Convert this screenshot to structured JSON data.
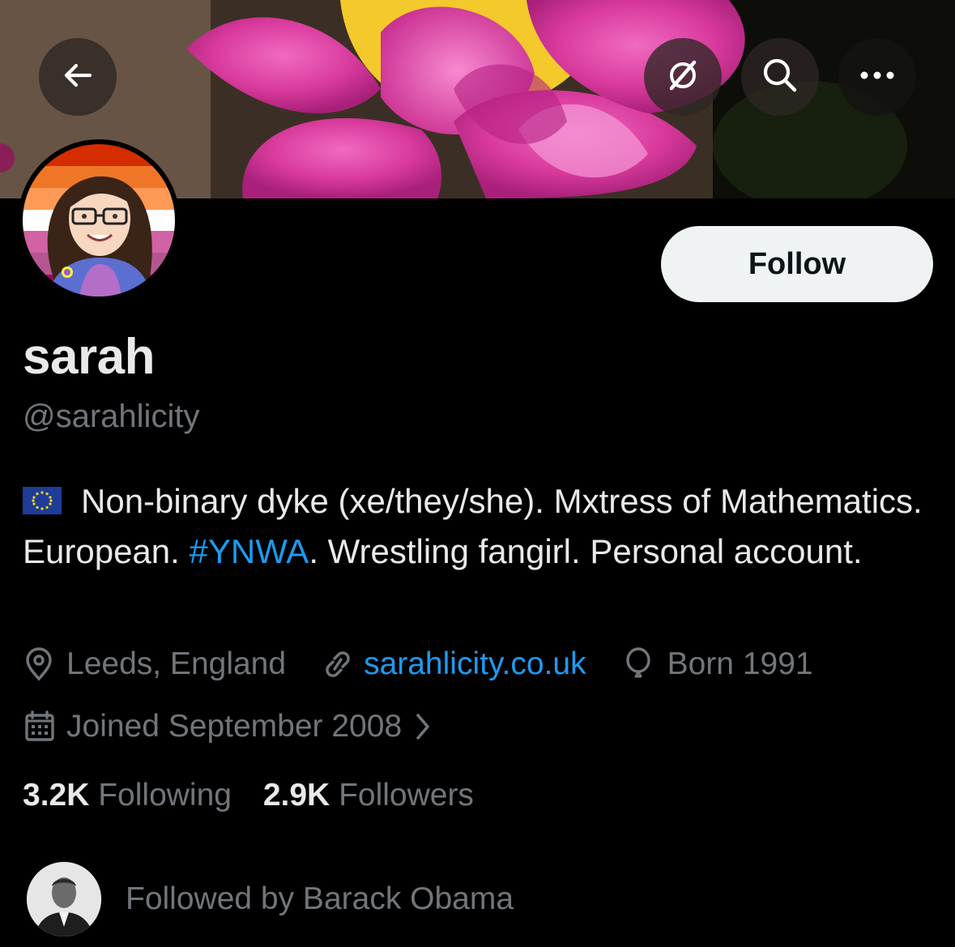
{
  "header": {
    "back_icon": "arrow-left-icon",
    "grok_icon": "slashed-circle-icon",
    "search_icon": "search-icon",
    "more_icon": "more-horizontal-icon"
  },
  "profile": {
    "follow_label": "Follow",
    "display_name": "sarah",
    "handle": "@sarahlicity",
    "bio": {
      "flag_icon": "eu-flag-icon",
      "text_before": "Non-binary dyke (xe/they/she). Mxtress of Mathematics. European. ",
      "hashtag": "#YNWA",
      "text_after": ". Wrestling fangirl. Personal account."
    },
    "location": "Leeds, England",
    "website": "sarahlicity.co.uk",
    "birth": "Born 1991",
    "joined": "Joined September 2008",
    "following_count": "3.2K",
    "following_label": "Following",
    "followers_count": "2.9K",
    "followers_label": "Followers",
    "followed_by": "Followed by Barack Obama"
  },
  "colors": {
    "background": "#000000",
    "text_primary": "#e7e9ea",
    "text_secondary": "#71767b",
    "link": "#1d9bf0",
    "follow_button_bg": "#eff3f4"
  }
}
